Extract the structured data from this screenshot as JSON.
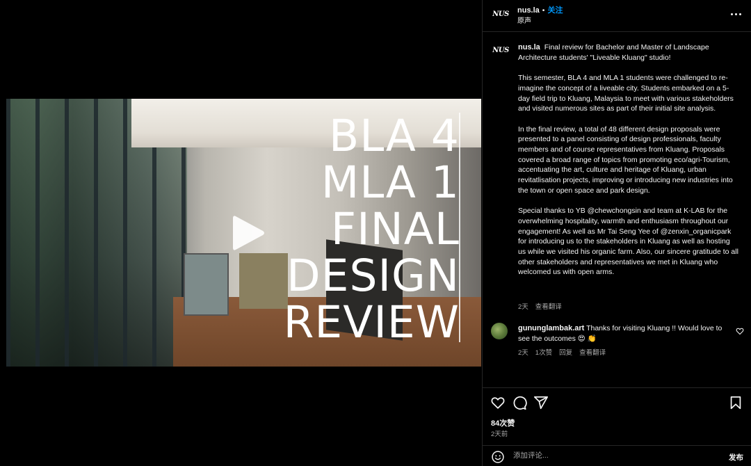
{
  "post": {
    "account": "nus.la",
    "avatar_text": "NUS",
    "follow_label": "关注",
    "audio_label": "原声",
    "video_title_lines": [
      "BLA 4",
      "MLA 1",
      "FINAL",
      "DESIGN",
      "REVIEW"
    ],
    "caption_paragraphs": [
      "Final review for Bachelor and Master of Landscape Architecture students' \"Liveable Kluang\" studio!",
      "This semester, BLA 4 and MLA 1 students were challenged to re-imagine the concept of a liveable city. Students embarked on a 5-day field trip to Kluang, Malaysia to meet with various stakeholders and visited numerous sites as part of their initial site analysis.",
      "In the final review, a total of 48 different design proposals were presented to a panel consisting of design professionals, faculty members and of course representatives from Kluang. Proposals covered a broad range of topics from promoting eco/agri-Tourism, accentuating the art, culture and heritage of Kluang, urban revitatlisation projects, improving or introducing new industries into the town or open space and park design.",
      "Special thanks to YB @chewchongsin and team at K-LAB for the overwhelming hospitality, warmth and enthusiasm throughout our engagement! As well as Mr Tai Seng Yee of @zenxin_organicpark for introducing us to the stakeholders in Kluang as well as hosting us while we visited his organic farm. Also, our sincere gratitude to all other stakeholders and representatives we met in Kluang who welcomed us with open arms."
    ],
    "caption_meta": {
      "age": "2天",
      "translate": "查看翻译"
    },
    "likes": "84次赞",
    "timestamp": "2天前"
  },
  "comments": [
    {
      "user": "gununglambak.art",
      "text": "Thanks for visiting Kluang !! Would love to see the outcomes 😍 👏",
      "age": "2天",
      "likes": "1次赞",
      "reply": "回复",
      "translate": "查看翻译"
    }
  ],
  "add_comment": {
    "placeholder": "添加评论...",
    "post_label": "发布"
  },
  "icons": {
    "play": "play-icon",
    "mute": "mute-icon",
    "more": "more-icon",
    "like": "heart-icon",
    "comment": "comment-icon",
    "share": "share-icon",
    "save": "bookmark-icon",
    "emoji": "emoji-icon"
  }
}
